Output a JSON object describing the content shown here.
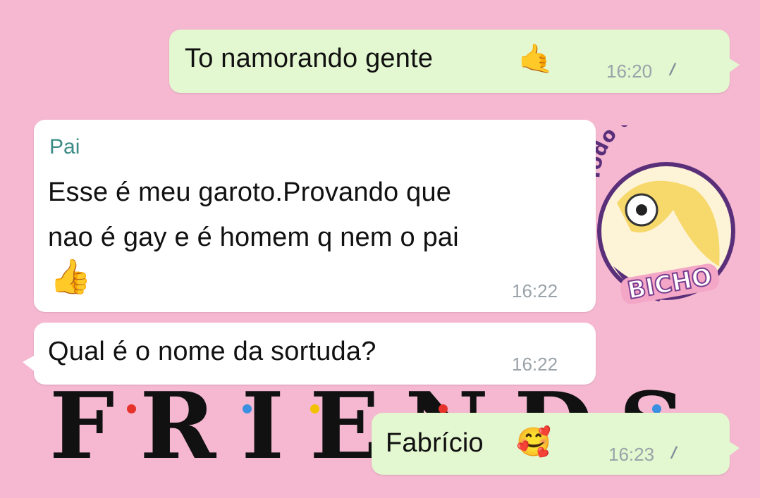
{
  "messages": [
    {
      "direction": "outgoing",
      "text": "To namorando gente",
      "emoji": "🤙",
      "time": "16:20",
      "ticks": "//"
    },
    {
      "direction": "incoming",
      "sender": "Pai",
      "text_line1": "Esse é meu garoto.Provando que",
      "text_line2": "nao é gay e é homem q nem o pai",
      "emoji": "👍",
      "time": "16:22"
    },
    {
      "direction": "incoming",
      "text": "Qual é o nome da sortuda?",
      "time": "16:22"
    },
    {
      "direction": "outgoing",
      "text": "Fabrício",
      "emoji": "🥰",
      "time": "16:23",
      "ticks": "//"
    }
  ],
  "background_text": "FRIENDS",
  "watermark": {
    "top_text": "Todo dia isso",
    "bottom_text": "BICHO"
  },
  "colors": {
    "background": "#f6b8d1",
    "outgoing_bubble": "#e3f7d0",
    "incoming_bubble": "#ffffff",
    "sender": "#3d8b86",
    "time": "#9aa3a9"
  }
}
